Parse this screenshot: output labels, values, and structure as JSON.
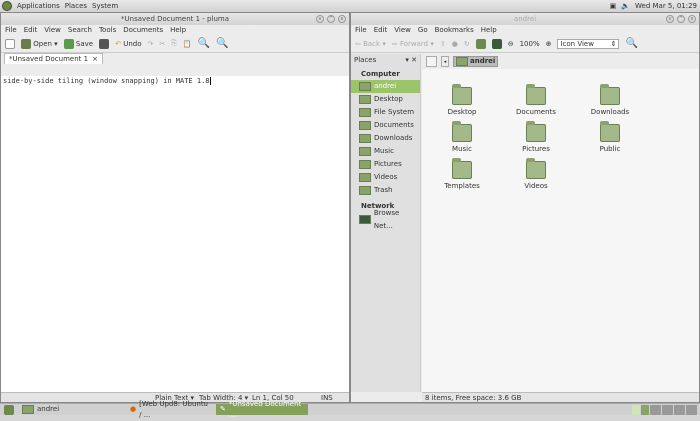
{
  "panel": {
    "menus": [
      "Applications",
      "Places",
      "System"
    ],
    "clock": "Wed Mar  5, 01:29"
  },
  "pluma": {
    "title": "*Unsaved Document 1 - pluma",
    "menu": [
      "File",
      "Edit",
      "View",
      "Search",
      "Tools",
      "Documents",
      "Help"
    ],
    "toolbar": {
      "open": "Open",
      "save": "Save",
      "undo": "Undo"
    },
    "tab": "*Unsaved Document 1",
    "text": "side-by-side tiling (window snapping) in MATE 1.8",
    "status": {
      "lang": "Plain Text ▾",
      "tab": "Tab Width:  4 ▾",
      "pos": "Ln 1, Col 50",
      "mode": "INS"
    }
  },
  "caja": {
    "title": "andrei",
    "menu": [
      "File",
      "Edit",
      "View",
      "Go",
      "Bookmarks",
      "Help"
    ],
    "toolbar": {
      "back": "Back",
      "forward": "Forward",
      "zoom": "100%",
      "view": "Icon View"
    },
    "places_label": "Places",
    "location": "andrei",
    "sidebar": {
      "computer": "Computer",
      "items": [
        "andrei",
        "Desktop",
        "File System",
        "Documents",
        "Downloads",
        "Music",
        "Pictures",
        "Videos",
        "Trash"
      ],
      "network": "Network",
      "net_items": [
        "Browse Net..."
      ]
    },
    "files": [
      "Desktop",
      "Documents",
      "Downloads",
      "Music",
      "Pictures",
      "Public",
      "Templates",
      "Videos"
    ],
    "status": "8 items, Free space: 3.6 GB"
  },
  "taskbar": [
    "andrei",
    "[Web Upd8: Ubuntu / ...",
    "*Unsaved Document ..."
  ]
}
